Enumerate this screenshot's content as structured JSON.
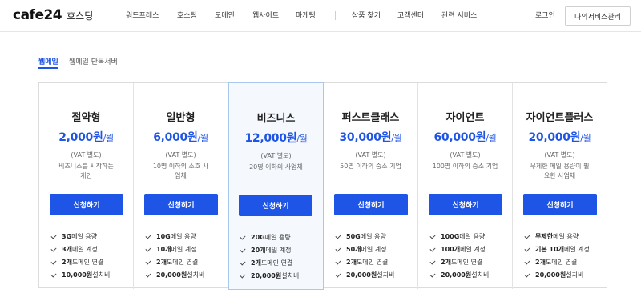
{
  "header": {
    "logo": "cafe24",
    "logo_sub": "호스팅",
    "nav": [
      "워드프레스",
      "호스팅",
      "도메인",
      "웹사이트",
      "마케팅",
      "상품 찾기",
      "고객센터",
      "관련 서비스"
    ],
    "login": "로그인",
    "mypage": "나의서비스관리"
  },
  "tabs": [
    "웹메일",
    "웹메일 단독서버"
  ],
  "plans": [
    {
      "name": "절약형",
      "price": "2,000원",
      "unit": "/월",
      "vat": "(VAT 별도)",
      "desc": "비즈니스를 시작하는 개인",
      "button": "신청하기",
      "features": [
        {
          "b": "3G",
          "t": " 메일 용량"
        },
        {
          "b": "3개",
          "t": " 메일 계정"
        },
        {
          "b": "2개",
          "t": " 도메인 연결"
        },
        {
          "b": "10,000원",
          "t": " 설치비"
        }
      ]
    },
    {
      "name": "일반형",
      "price": "6,000원",
      "unit": "/월",
      "vat": "(VAT 별도)",
      "desc": "10명 이하의 소호 사업체",
      "button": "신청하기",
      "features": [
        {
          "b": "10G",
          "t": " 메일 용량"
        },
        {
          "b": "10개",
          "t": " 메일 계정"
        },
        {
          "b": "2개",
          "t": " 도메인 연결"
        },
        {
          "b": "20,000원",
          "t": " 설치비"
        }
      ]
    },
    {
      "name": "비즈니스",
      "price": "12,000원",
      "unit": "/월",
      "vat": "(VAT 별도)",
      "desc": "20명 이하의 사업체",
      "button": "신청하기",
      "features": [
        {
          "b": "20G",
          "t": " 메일 용량"
        },
        {
          "b": "20개",
          "t": " 메일 계정"
        },
        {
          "b": "2개",
          "t": " 도메인 연결"
        },
        {
          "b": "20,000원",
          "t": " 설치비"
        }
      ]
    },
    {
      "name": "퍼스트클래스",
      "price": "30,000원",
      "unit": "/월",
      "vat": "(VAT 별도)",
      "desc": "50명 이하의 중소 기업",
      "button": "신청하기",
      "features": [
        {
          "b": "50G",
          "t": " 메일 용량"
        },
        {
          "b": "50개",
          "t": " 메일 계정"
        },
        {
          "b": "2개",
          "t": " 도메인 연결"
        },
        {
          "b": "20,000원",
          "t": " 설치비"
        }
      ]
    },
    {
      "name": "자이언트",
      "price": "60,000원",
      "unit": "/월",
      "vat": "(VAT 별도)",
      "desc": "100명 이하의 중소 기업",
      "button": "신청하기",
      "features": [
        {
          "b": "100G",
          "t": " 메일 용량"
        },
        {
          "b": "100개",
          "t": " 메일 계정"
        },
        {
          "b": "2개",
          "t": " 도메인 연결"
        },
        {
          "b": "20,000원",
          "t": " 설치비"
        }
      ]
    },
    {
      "name": "자이언트플러스",
      "price": "20,000원",
      "unit": "/월",
      "vat": "(VAT 별도)",
      "desc": "무제한 메일 용량이 필요한 사업체",
      "button": "신청하기",
      "features": [
        {
          "b": "무제한",
          "t": " 메일 용량"
        },
        {
          "b": "기본 10개",
          "t": " 메일 계정"
        },
        {
          "b": "2개",
          "t": " 도메인 연결"
        },
        {
          "b": "20,000원",
          "t": " 설치비"
        }
      ]
    }
  ]
}
